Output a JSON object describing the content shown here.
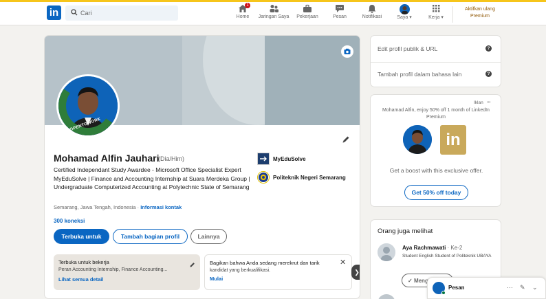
{
  "nav": {
    "logo": "in",
    "search_placeholder": "Cari",
    "items": [
      {
        "label": "Home",
        "icon": "home-icon"
      },
      {
        "label": "Jaringan Saya",
        "icon": "network-icon"
      },
      {
        "label": "Pekerjaan",
        "icon": "briefcase-icon"
      },
      {
        "label": "Pesan",
        "icon": "message-icon"
      },
      {
        "label": "Notifikasi",
        "icon": "bell-icon"
      },
      {
        "label": "Saya",
        "icon": "avatar-icon"
      },
      {
        "label": "Kerja",
        "icon": "grid-icon"
      }
    ],
    "home_badge": "1",
    "premium_line1": "Aktifkan ulang",
    "premium_line2": "Premium"
  },
  "profile": {
    "avatar_frame_text": "#OPENTOWORK",
    "name": "Mohamad Alfin Jauhari",
    "pronoun": "(Dia/Him)",
    "headline": "Certified Independant Study Awardee - Microsoft Office Specialist Expert MyEduSolve | Finance and Accounting Internship at Suara Merdeka Group | Undergraduate Computerized Accounting at Polytechnic State of Semarang",
    "location": "Semarang, Jawa Tengah, Indonesia",
    "contact_info": "Informasi kontak",
    "connections": "300 koneksi",
    "orgs": [
      {
        "name": "MyEduSolve"
      },
      {
        "name": "Politeknik Negeri Semarang"
      }
    ],
    "buttons": {
      "open_to": "Terbuka untuk",
      "add_section": "Tambah bagian profil",
      "more": "Lainnya"
    },
    "open_to_work": {
      "title": "Terbuka untuk bekerja",
      "text": "Peran Accounting Internship, Finance Accounting...",
      "link": "Lihat semua detail"
    },
    "hiring": {
      "title": "Bagikan bahwa Anda sedang merekrut dan tarik",
      "text": "kandidat yang berkualifikasi.",
      "link": "Mulai"
    }
  },
  "sidebar": {
    "edit_public_profile": "Edit profil publik & URL",
    "add_language_profile": "Tambah profil dalam bahasa lain",
    "ad": {
      "label": "Iklan",
      "text": "Mohamad Alfin, enjoy 50% off 1 month of LinkedIn Premium",
      "offer": "Get a boost with this exclusive offer.",
      "button": "Get 50% off today",
      "brand": "in"
    },
    "people": {
      "title": "Orang juga melihat",
      "person_name": "Aya Rachmawati",
      "person_degree": "· Ke-2",
      "person_headline": "Student English Student of Politeknik UBAYA",
      "button": "Mengikuti"
    }
  },
  "messaging": {
    "label": "Pesan"
  },
  "colors": {
    "accent": "#0a66c2",
    "premium_gold": "#915907",
    "open_to_work_green": "#2f7d3a"
  }
}
